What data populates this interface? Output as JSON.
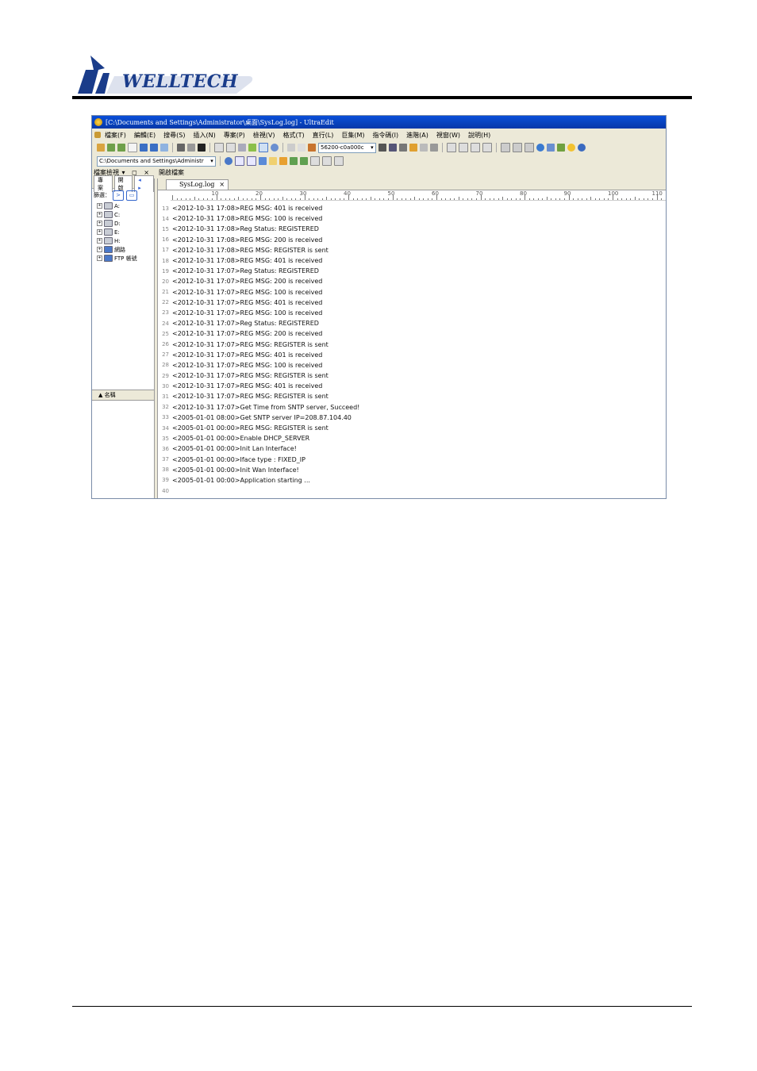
{
  "doc": {
    "logo_text": "WELLTECH"
  },
  "window": {
    "title": "[C:\\Documents and Settings\\Administrator\\桌面\\SysLog.log] - UltraEdit",
    "menu": [
      "檔案(F)",
      "編輯(E)",
      "搜尋(S)",
      "插入(N)",
      "專案(P)",
      "檢視(V)",
      "格式(T)",
      "直行(L)",
      "巨集(M)",
      "指令碼(I)",
      "進階(A)",
      "視窗(W)",
      "說明(H)"
    ],
    "toolbar": {
      "encoding_combo": "56200-c0a000c",
      "path_combo": "C:\\Documents and Settings\\Administr"
    },
    "left_panel": {
      "header": "檔案檢視",
      "header_controls": "▾ ◻ ×",
      "tabs": [
        "專案",
        "開啟"
      ],
      "tab_arrows": "◂ ▸",
      "filter_label": "篩選：",
      "drives": [
        "A:",
        "C:",
        "D:",
        "E:",
        "H:",
        "網路",
        "FTP 帳號"
      ],
      "column_header": "▲ 名稱"
    },
    "editor": {
      "panel_header": "開啟檔案",
      "tab_label": "SysLog.log",
      "tab_close": "×",
      "ruler_labels": [
        "10",
        "20",
        "30",
        "40",
        "50",
        "60",
        "70",
        "80",
        "90",
        "100",
        "110"
      ],
      "lines": [
        {
          "n": "13",
          "text": "<2012-10-31 17:08>REG MSG: 401 is received"
        },
        {
          "n": "14",
          "text": "<2012-10-31 17:08>REG MSG: 100 is received"
        },
        {
          "n": "15",
          "text": "<2012-10-31 17:08>Reg Status: REGISTERED"
        },
        {
          "n": "16",
          "text": "<2012-10-31 17:08>REG MSG: 200 is received"
        },
        {
          "n": "17",
          "text": "<2012-10-31 17:08>REG MSG: REGISTER is sent"
        },
        {
          "n": "18",
          "text": "<2012-10-31 17:08>REG MSG: 401 is received"
        },
        {
          "n": "19",
          "text": "<2012-10-31 17:07>Reg Status: REGISTERED"
        },
        {
          "n": "20",
          "text": "<2012-10-31 17:07>REG MSG: 200 is received"
        },
        {
          "n": "21",
          "text": "<2012-10-31 17:07>REG MSG: 100 is received"
        },
        {
          "n": "22",
          "text": "<2012-10-31 17:07>REG MSG: 401 is received"
        },
        {
          "n": "23",
          "text": "<2012-10-31 17:07>REG MSG: 100 is received"
        },
        {
          "n": "24",
          "text": "<2012-10-31 17:07>Reg Status: REGISTERED"
        },
        {
          "n": "25",
          "text": "<2012-10-31 17:07>REG MSG: 200 is received"
        },
        {
          "n": "26",
          "text": "<2012-10-31 17:07>REG MSG: REGISTER is sent"
        },
        {
          "n": "27",
          "text": "<2012-10-31 17:07>REG MSG: 401 is received"
        },
        {
          "n": "28",
          "text": "<2012-10-31 17:07>REG MSG: 100 is received"
        },
        {
          "n": "29",
          "text": "<2012-10-31 17:07>REG MSG: REGISTER is sent"
        },
        {
          "n": "30",
          "text": "<2012-10-31 17:07>REG MSG: 401 is received"
        },
        {
          "n": "31",
          "text": "<2012-10-31 17:07>REG MSG: REGISTER is sent"
        },
        {
          "n": "32",
          "text": "<2012-10-31 17:07>Get Time from SNTP server, Succeed!"
        },
        {
          "n": "33",
          "text": "<2005-01-01 08:00>Get SNTP server IP=208.87.104.40"
        },
        {
          "n": "34",
          "text": "<2005-01-01 00:00>REG MSG: REGISTER is sent"
        },
        {
          "n": "35",
          "text": "<2005-01-01 00:00>Enable DHCP_SERVER"
        },
        {
          "n": "36",
          "text": "<2005-01-01 00:00>Init Lan Interface!"
        },
        {
          "n": "37",
          "text": "<2005-01-01 00:00>Iface type : FIXED_IP"
        },
        {
          "n": "38",
          "text": "<2005-01-01 00:00>Init Wan Interface!"
        },
        {
          "n": "39",
          "text": "<2005-01-01 00:00>Application starting ..."
        },
        {
          "n": "40",
          "text": ""
        }
      ]
    }
  },
  "colors": {
    "brand_blue": "#1a3c8a",
    "titlebar": "#0a4fd9",
    "chrome": "#ece9d8"
  }
}
